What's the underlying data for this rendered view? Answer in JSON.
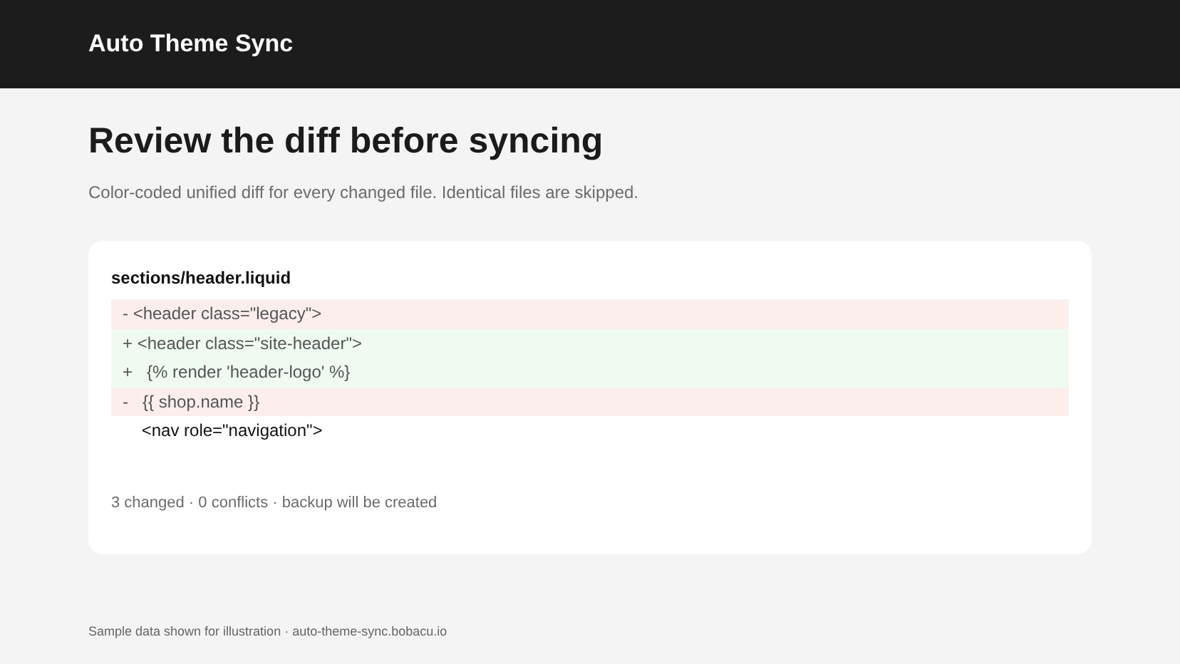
{
  "app_title": "Auto Theme Sync",
  "heading": "Review the diff before syncing",
  "subtitle": "Color-coded unified diff for every changed file. Identical files are skipped.",
  "diff": {
    "file": "sections/header.liquid",
    "lines": [
      {
        "kind": "removed",
        "text": "- <header class=\"legacy\">"
      },
      {
        "kind": "added",
        "text": "+ <header class=\"site-header\">"
      },
      {
        "kind": "added",
        "text": "+   {% render 'header-logo' %}"
      },
      {
        "kind": "removed",
        "text": "-   {{ shop.name }}"
      },
      {
        "kind": "context",
        "text": "    <nav role=\"navigation\">"
      }
    ],
    "summary": "3 changed · 0 conflicts · backup will be created"
  },
  "footer": "Sample data shown for illustration · auto-theme-sync.bobacu.io"
}
